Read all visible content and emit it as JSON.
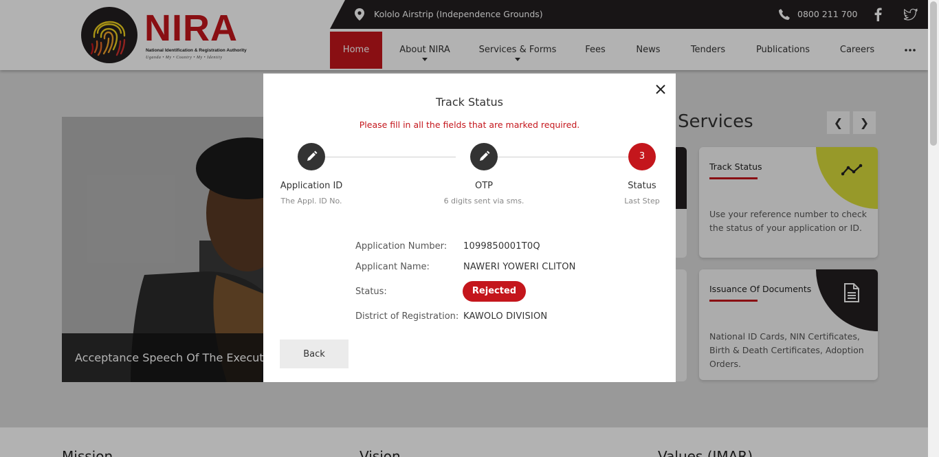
{
  "colors": {
    "brand_red": "#c4161c",
    "dark": "#231f20",
    "accent_yellow": "#d9dc3b"
  },
  "logo": {
    "word": "NIRA",
    "subtitle": "National Identification & Registration Authority",
    "tagline": "Uganda  •  My  •  Country  •  My  •  Identity"
  },
  "topbar": {
    "location": "Kololo Airstrip (Independence Grounds)",
    "phone": "0800 211 700",
    "icons": [
      "location-pin-icon",
      "phone-icon",
      "facebook-icon",
      "twitter-icon"
    ]
  },
  "nav": {
    "items": [
      {
        "label": "Home",
        "active": true
      },
      {
        "label": "About NIRA",
        "has_dropdown": true
      },
      {
        "label": "Services & Forms",
        "has_dropdown": true
      },
      {
        "label": "Fees"
      },
      {
        "label": "News"
      },
      {
        "label": "Tenders"
      },
      {
        "label": "Publications"
      },
      {
        "label": "Careers"
      }
    ],
    "more_icon": "more-dots-icon"
  },
  "hero": {
    "caption": "Acceptance Speech Of The Executi"
  },
  "services": {
    "title": "Services",
    "prev_icon": "chevron-left-icon",
    "next_icon": "chevron-right-icon",
    "cards": [
      {
        "title": "Track Status",
        "icon": "trend-line-icon",
        "description": "Use your reference number to check the status of your application or ID."
      },
      {
        "title": "Issuance Of Documents",
        "icon": "document-icon",
        "description": "National ID Cards, NIN Certificates, Birth & Death Certificates, Adoption Orders."
      }
    ]
  },
  "bottom": {
    "col1": "Mission",
    "col2": "Vision",
    "col3": "Values (IMAR)"
  },
  "modal": {
    "title": "Track Status",
    "warning": "Please fill in all the fields that are marked required.",
    "close_icon": "close-icon",
    "steps": [
      {
        "label": "Application ID",
        "sub": "The Appl. ID No.",
        "state": "done",
        "icon": "pencil-icon"
      },
      {
        "label": "OTP",
        "sub": "6 digits sent via sms.",
        "state": "done",
        "icon": "pencil-icon"
      },
      {
        "label": "Status",
        "sub": "Last Step",
        "state": "current",
        "number": "3"
      }
    ],
    "fields": {
      "application_number": {
        "label": "Application Number:",
        "value": "1099850001T0Q"
      },
      "applicant_name": {
        "label": "Applicant Name:",
        "value": "NAWERI YOWERI CLITON"
      },
      "status": {
        "label": "Status:",
        "value": "Rejected"
      },
      "district": {
        "label": "District of Registration:",
        "value": "KAWOLO DIVISION"
      }
    },
    "back_label": "Back"
  }
}
